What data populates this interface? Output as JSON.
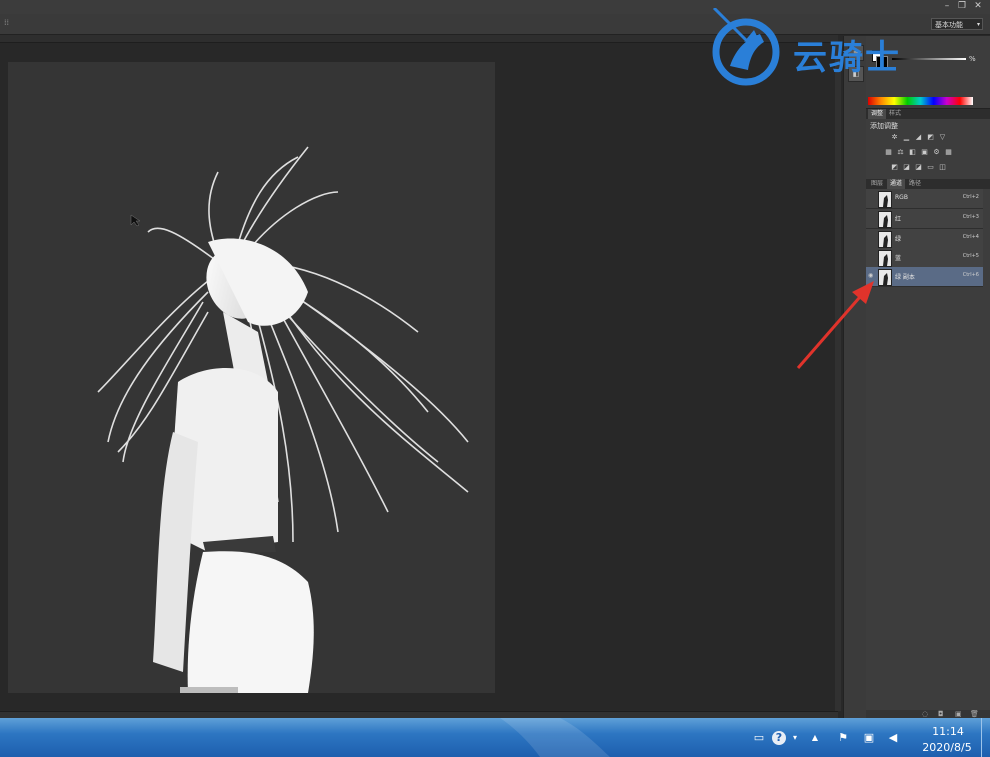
{
  "app": {
    "workspace_label": "基本功能",
    "tool_glyph": "⁞⁞",
    "window_buttons": [
      "–",
      "❐",
      "✕"
    ]
  },
  "panels": {
    "opacity_label": "%",
    "adjust_tabs": [
      "调整",
      "样式"
    ],
    "adjust_title": "添加调整",
    "channel_tabs": [
      "图层",
      "通道",
      "路径"
    ],
    "channels": [
      {
        "name": "RGB",
        "shortcut": "Ctrl+2"
      },
      {
        "name": "红",
        "shortcut": "Ctrl+3"
      },
      {
        "name": "绿",
        "shortcut": "Ctrl+4"
      },
      {
        "name": "蓝",
        "shortcut": "Ctrl+5"
      },
      {
        "name": "绿 副本",
        "shortcut": "Ctrl+6"
      }
    ],
    "selected_channel": "绿 副本"
  },
  "watermark": {
    "text": "云骑士"
  },
  "taskbar": {
    "time": "11:14",
    "date": "2020/8/5"
  },
  "colors": {
    "accent_blue": "#2a7fd8",
    "selection": "#5a6b86",
    "arrow": "#e0332b"
  }
}
